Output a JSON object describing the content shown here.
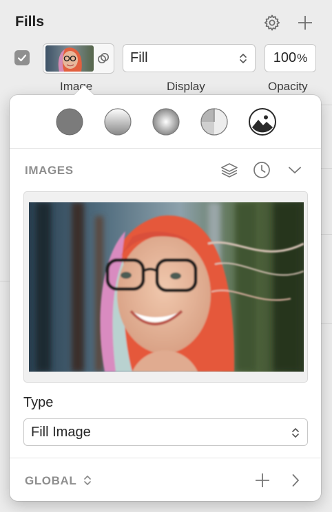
{
  "fills": {
    "title": "Fills",
    "settings_icon": "gear-icon",
    "add_icon": "plus-icon",
    "enabled": true,
    "display_value": "Fill",
    "opacity_value": "100",
    "opacity_unit": "%",
    "labels": {
      "image": "Image",
      "display": "Display",
      "opacity": "Opacity"
    }
  },
  "popover": {
    "fill_types": [
      {
        "name": "solid-color",
        "icon": "solid-circle-icon"
      },
      {
        "name": "linear-gradient",
        "icon": "linear-gradient-icon"
      },
      {
        "name": "radial-gradient",
        "icon": "radial-gradient-icon"
      },
      {
        "name": "angular-gradient",
        "icon": "angular-gradient-icon"
      },
      {
        "name": "image",
        "icon": "image-fill-icon",
        "selected": true
      }
    ],
    "images_header": "IMAGES",
    "images_icons": [
      "layers-icon",
      "clock-icon",
      "chevron-down-icon"
    ],
    "type_label": "Type",
    "type_value": "Fill Image",
    "global_label": "GLOBAL"
  }
}
